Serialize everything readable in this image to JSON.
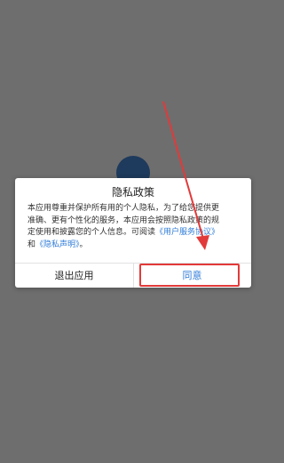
{
  "dialog": {
    "title": "隐私政策",
    "body_line1": "本应用尊重并保护所有用的个人隐私，为了给您提供更",
    "body_line2": "准确、更有个性化的服务，本应用会按照隐私政策的规",
    "body_line3_prefix": "定使用和披露您的个人信息。可阅读",
    "link_user_agreement": "《用户服务协议》",
    "body_line4_prefix": "和",
    "link_privacy_statement": "《隐私声明》",
    "body_line4_suffix": "。",
    "exit_button": "退出应用",
    "agree_button": "同意"
  },
  "colors": {
    "overlay": "#6e6e6e",
    "link": "#2f7bd8",
    "annotation": "#e23a3a"
  }
}
